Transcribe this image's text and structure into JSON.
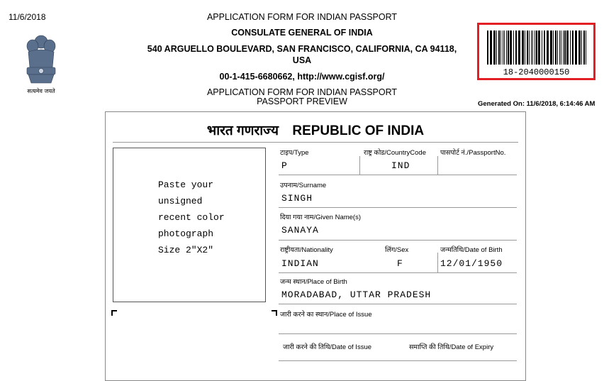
{
  "print_date": "11/6/2018",
  "header": {
    "title": "APPLICATION FORM FOR INDIAN PASSPORT",
    "consulate": "CONSULATE GENERAL OF INDIA",
    "address": "540 ARGUELLO BOULEVARD, SAN FRANCISCO, CALIFORNIA, CA 94118,",
    "country": "USA",
    "contact": "00-1-415-6680662, http://www.cgisf.org/",
    "form_title": "APPLICATION FORM FOR INDIAN PASSPORT",
    "preview": "PASSPORT PREVIEW"
  },
  "emblem_caption": "सत्यमेव जयते",
  "barcode": {
    "number": "18-2040000150",
    "border_color": "#e31e24"
  },
  "generated": "Generated On: 11/6/2018, 6:14:46 AM",
  "card": {
    "title_hindi": "भारत गणराज्य",
    "title_english": "REPUBLIC OF INDIA",
    "photo_lines": [
      "Paste your",
      "unsigned",
      "recent color",
      "photograph",
      "Size 2\"X2\""
    ],
    "fields": {
      "type_label": "टाइप/Type",
      "type_value": "P",
      "country_code_label": "राष्ट्र कोड/CountryCode",
      "country_code_value": "IND",
      "passport_no_label": "पासपोर्ट नं./PassportNo.",
      "surname_label": "उपनाम/Surname",
      "surname_value": "SINGH",
      "given_name_label": "दिया गया नाम/Given Name(s)",
      "given_name_value": "SANAYA",
      "nationality_label": "राष्ट्रीयता/Nationality",
      "nationality_value": "INDIAN",
      "sex_label": "लिंग/Sex",
      "sex_value": "F",
      "dob_label": "जन्मतिथि/Date of Birth",
      "dob_value": "12/01/1950",
      "pob_label": "जन्म स्थान/Place of Birth",
      "pob_value": "MORADABAD, UTTAR PRADESH",
      "poi_label": "जारी करने का स्थान/Place of Issue",
      "doi_label": "जारी करने की तिथि/Date of Issue",
      "doe_label": "समाप्ति की तिथि/Date of Expiry"
    }
  }
}
